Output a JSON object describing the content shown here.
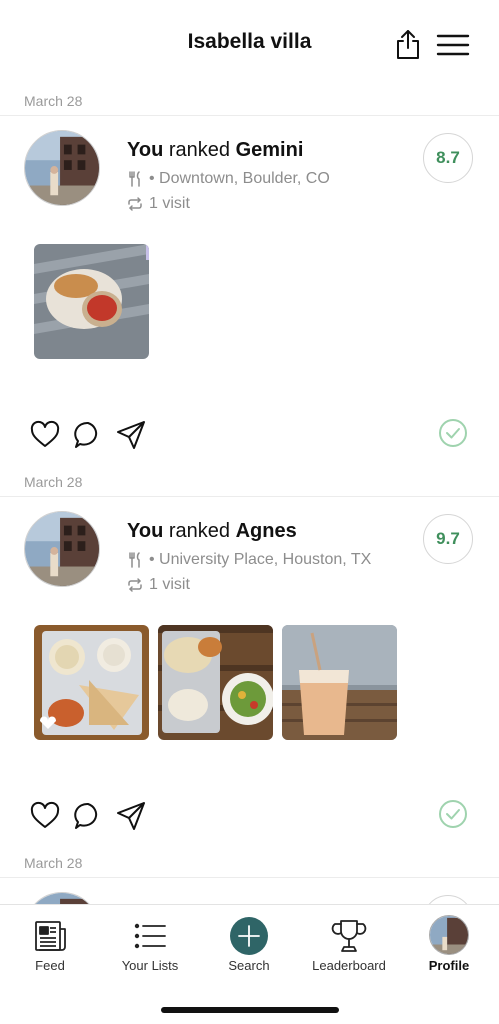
{
  "header": {
    "title": "Isabella villa",
    "share_icon": "share-icon",
    "menu_icon": "hamburger-menu-icon"
  },
  "posts": [
    {
      "date": "March 28",
      "you": "You",
      "ranked": "ranked",
      "restaurant": "Gemini",
      "location": "Downtown, Boulder, CO",
      "visits": "1 visit",
      "score": "8.7",
      "photo_count": 1
    },
    {
      "date": "March 28",
      "you": "You",
      "ranked": "ranked",
      "restaurant": "Agnes",
      "location": "University Place, Houston, TX",
      "visits": "1 visit",
      "score": "9.7",
      "photo_count": 3
    },
    {
      "date": "March 28"
    }
  ],
  "colors": {
    "score_text": "#3f8f5c",
    "check_green": "#9fd3ae",
    "search_button": "#2f6567",
    "divider": "#ececec"
  },
  "tabs": [
    {
      "label": "Feed",
      "icon": "newspaper-icon",
      "active": false
    },
    {
      "label": "Your Lists",
      "icon": "list-icon",
      "active": false
    },
    {
      "label": "Search",
      "icon": "plus-icon",
      "active": false
    },
    {
      "label": "Leaderboard",
      "icon": "trophy-icon",
      "active": false
    },
    {
      "label": "Profile",
      "icon": "profile-avatar",
      "active": true
    }
  ]
}
